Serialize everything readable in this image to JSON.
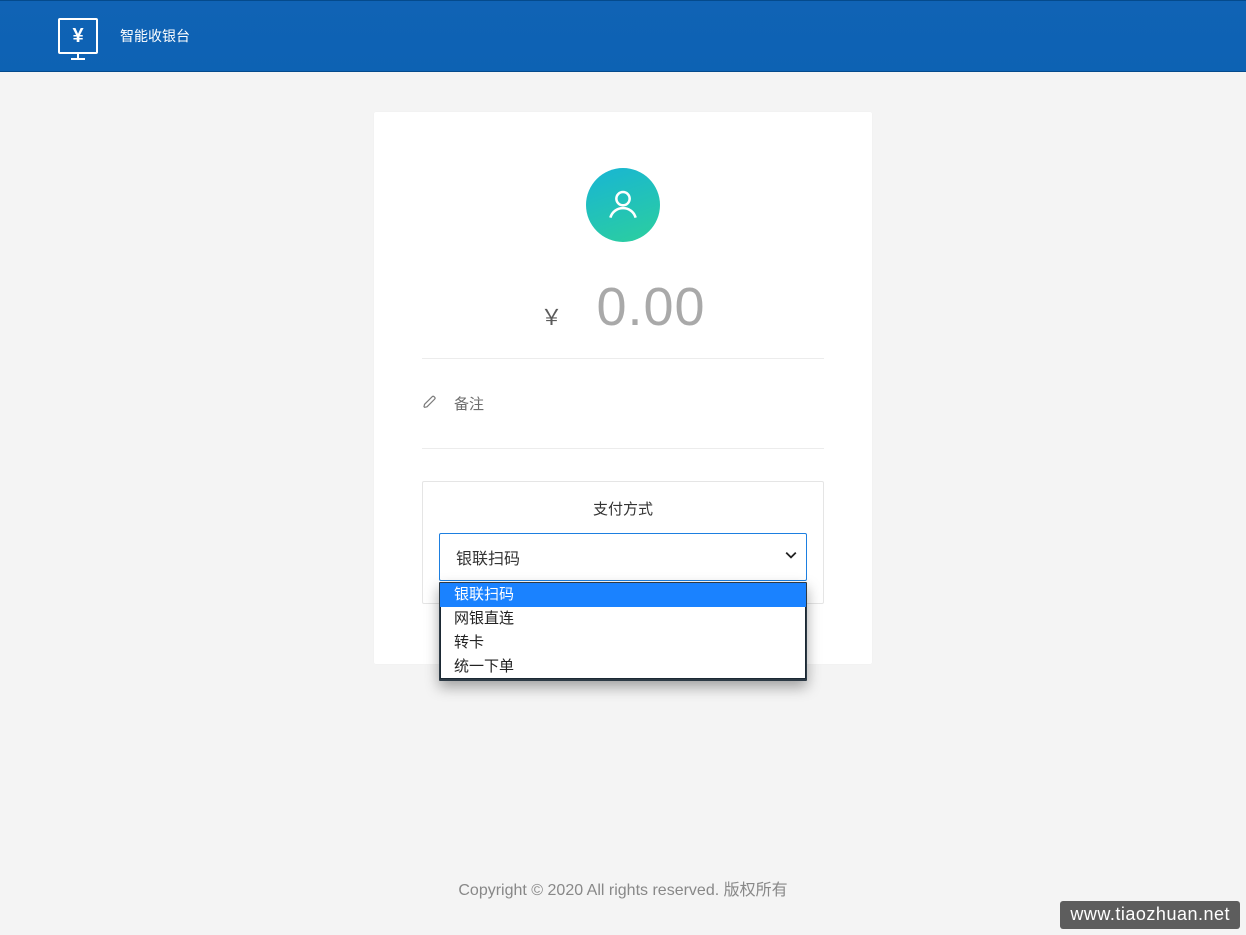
{
  "header": {
    "logo_symbol": "¥",
    "title": "智能收银台"
  },
  "card": {
    "currency_symbol": "￥",
    "amount": "0.00",
    "note_label": "备注",
    "payment": {
      "title": "支付方式",
      "selected": "银联扫码",
      "options": [
        "银联扫码",
        "网银直连",
        "转卡",
        "统一下单"
      ]
    }
  },
  "footer": {
    "text": "Copyright © 2020 All rights reserved. 版权所有"
  },
  "watermark": "www.tiaozhuan.net"
}
